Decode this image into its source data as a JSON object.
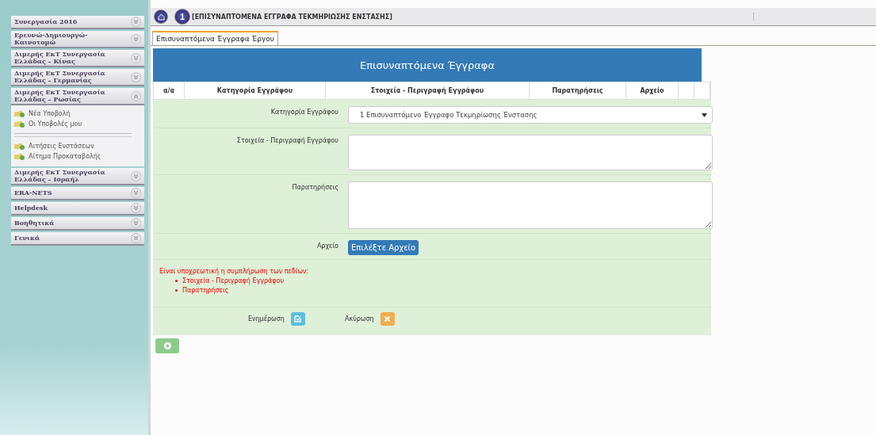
{
  "sidebar": {
    "sections": [
      {
        "title": "Συνεργασία 2016",
        "expanded": false
      },
      {
        "title": "Ερευνώ-Δημιουργώ-Καινοτομώ",
        "expanded": false
      },
      {
        "title": "Διμερής ΕκΤ Συνεργασία Ελλάδας – Κίνας",
        "expanded": false
      },
      {
        "title": "Διμερής ΕκΤ Συνεργασία Ελλάδας – Γερμανίας",
        "expanded": false
      },
      {
        "title": "Διμερής ΕκΤ Συνεργασία Ελλάδας – Ρωσίας",
        "expanded": true,
        "items": [
          {
            "kind": "link",
            "label": "Νέα Υποβολή"
          },
          {
            "kind": "link",
            "label": "Οι Υποβολές μου"
          },
          {
            "kind": "separator"
          },
          {
            "kind": "link",
            "label": "Αιτήσεις Ενστάσεων"
          },
          {
            "kind": "link",
            "label": "Αίτημα Προκαταβολής"
          }
        ]
      },
      {
        "title": "Διμερής ΕκΤ Συνεργασία Ελλάδας – Ισραήλ",
        "expanded": false
      },
      {
        "title": "ERA-NETS",
        "expanded": false
      },
      {
        "title": "Helpdesk",
        "expanded": false
      },
      {
        "title": "Βοηθητικά",
        "expanded": false
      },
      {
        "title": "Γενικά",
        "expanded": false
      }
    ]
  },
  "toolbar": {
    "step": "1",
    "title": "[ΕΠΙΣΥΝΑΠΤΟΜΕΝΑ ΕΓΓΡΑΦΑ ΤΕΚΜΗΡΙΩΣΗΣ ΕΝΣΤΑΣΗΣ]"
  },
  "tabs": [
    {
      "label": "Επισυναπτόμενα Έγγραφα Έργου",
      "selected": true
    }
  ],
  "panel": {
    "title": "Επισυναπτόμενα Έγγραφα",
    "columns": [
      "α/α",
      "Κατηγορία Εγγράφου",
      "Στοιχεία - Περιγραφή Εγγράφου",
      "Παρατηρήσεις",
      "Αρχείο"
    ],
    "fields": [
      {
        "kind": "select",
        "label": "Κατηγορία Εγγράφου",
        "value": "1 Επισυναπτόμενο Έγγραφο Τεκμηρίωσης Ένστασης"
      },
      {
        "kind": "textarea",
        "label": "Στοιχεία - Περιγραφή Εγγράφου",
        "tall": false
      },
      {
        "kind": "textarea",
        "label": "Παρατηρήσεις",
        "tall": true
      },
      {
        "kind": "file",
        "label": "Αρχείο",
        "button": "Επιλέξτε Αρχείο"
      }
    ],
    "validation": {
      "message": "Είναι υποχρεωτική η συμπλήρωση των πεδίων:",
      "items": [
        "Στοιχεία - Περιγραφή Εγγράφου",
        "Παρατηρήσεις"
      ]
    },
    "actions": [
      {
        "kind": "update",
        "label": "Ενημέρωση"
      },
      {
        "kind": "cancel",
        "label": "Ακύρωση"
      }
    ]
  }
}
